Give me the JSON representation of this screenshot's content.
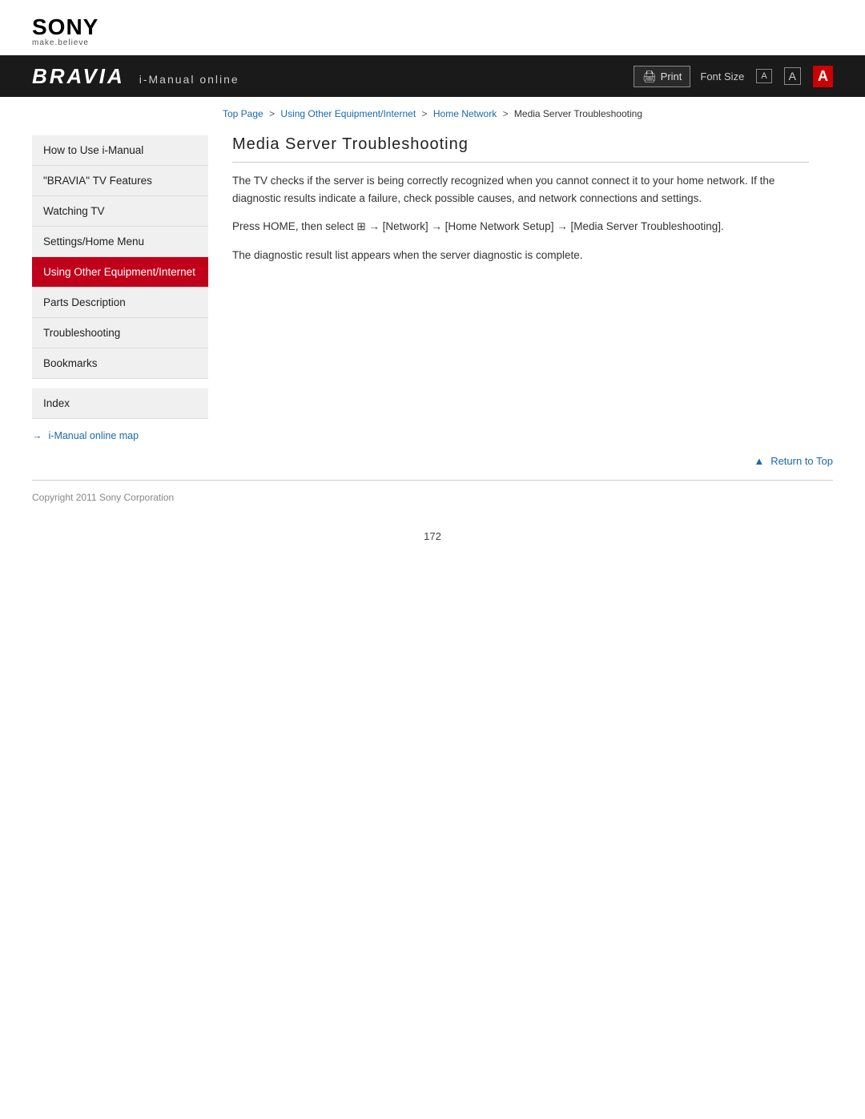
{
  "logo": {
    "brand": "SONY",
    "tagline": "make.believe"
  },
  "header": {
    "bravia_title": "BRAVIA",
    "imanual_label": "i-Manual online",
    "print_btn": "Print",
    "font_size_label": "Font Size",
    "font_a_small": "A",
    "font_a_medium": "A",
    "font_a_large": "A"
  },
  "breadcrumb": {
    "items": [
      {
        "label": "Top Page",
        "href": "#"
      },
      {
        "label": "Using Other Equipment/Internet",
        "href": "#"
      },
      {
        "label": "Home Network",
        "href": "#"
      },
      {
        "label": "Media Server Troubleshooting",
        "href": null
      }
    ]
  },
  "sidebar": {
    "items": [
      {
        "label": "How to Use i-Manual",
        "active": false
      },
      {
        "label": "\"BRAVIA\" TV Features",
        "active": false
      },
      {
        "label": "Watching TV",
        "active": false
      },
      {
        "label": "Settings/Home Menu",
        "active": false
      },
      {
        "label": "Using Other Equipment/Internet",
        "active": true
      },
      {
        "label": "Parts Description",
        "active": false
      },
      {
        "label": "Troubleshooting",
        "active": false
      },
      {
        "label": "Bookmarks",
        "active": false
      }
    ],
    "index_item": "Index",
    "map_link": "i-Manual online map"
  },
  "content": {
    "title": "Media Server Troubleshooting",
    "para1": "The TV checks if the server is being correctly recognized when you cannot connect it to your home network. If the diagnostic results indicate a failure, check possible causes, and network connections and settings.",
    "para2_prefix": "Press HOME, then select ",
    "para2_icon": "⊞",
    "para2_suffix": " → [Network] → [Home Network Setup] → [Media Server Troubleshooting].",
    "para3": "The diagnostic result list appears when the server diagnostic is complete."
  },
  "footer": {
    "return_top": "Return to Top",
    "copyright": "Copyright 2011 Sony Corporation",
    "page_number": "172"
  }
}
